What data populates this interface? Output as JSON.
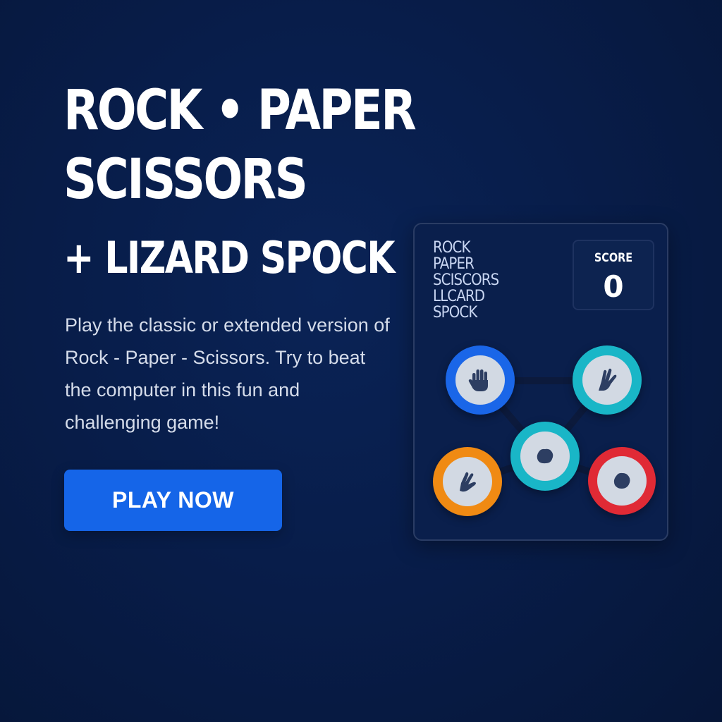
{
  "hero": {
    "title_line1": "ROCK • PAPER",
    "title_line2": "SCISSORS",
    "subtitle": "+ LIZARD SPOCK",
    "description": "Play the classic or extended version of Rock - Paper - Scissors. Try to beat the computer in this fun and challenging game!",
    "cta_label": "PLAY NOW"
  },
  "panel": {
    "list": [
      "ROCK",
      "PAPER",
      "SCISCORS",
      "LLCARD",
      "SPOCK"
    ],
    "score_label": "SCORE",
    "score_value": "0"
  },
  "choices": [
    {
      "name": "paper",
      "icon": "open-hand-icon",
      "ring_color": "#1a66e8"
    },
    {
      "name": "spock",
      "icon": "spock-hand-icon",
      "ring_color": "#19b6c7"
    },
    {
      "name": "rock",
      "icon": "rock-icon",
      "ring_color": "#19b6c7"
    },
    {
      "name": "lizard",
      "icon": "lizard-hand-icon",
      "ring_color": "#f08a13"
    },
    {
      "name": "rock-alt",
      "icon": "rock-icon",
      "ring_color": "#e02a35"
    }
  ],
  "colors": {
    "background": "#081d4a",
    "accent": "#1565e8",
    "icon": "#2d3e62"
  }
}
